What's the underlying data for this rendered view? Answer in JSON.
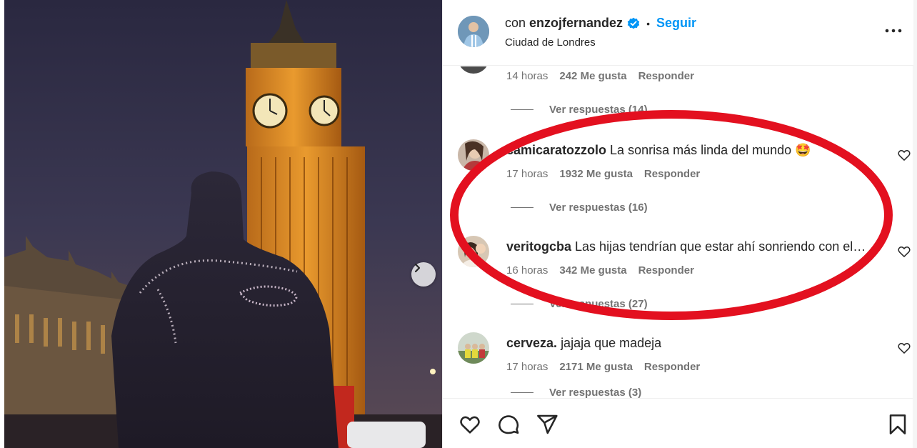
{
  "post": {
    "header": {
      "prefix": "con",
      "username": "enzojfernandez",
      "separator": "•",
      "follow_label": "Seguir",
      "location": "Ciudad de Londres",
      "more_icon": "more-horizontal-icon"
    },
    "carousel": {
      "next_icon": "chevron-right-icon"
    }
  },
  "comments": [
    {
      "user": "",
      "text": "",
      "time": "14 horas",
      "likes": "242 Me gusta",
      "reply": "Responder",
      "view_replies": "Ver respuestas (14)"
    },
    {
      "user": "camicaratozzolo",
      "text": "La sonrisa más linda del mundo 🤩",
      "time": "17 horas",
      "likes": "1932 Me gusta",
      "reply": "Responder",
      "view_replies": "Ver respuestas (16)"
    },
    {
      "user": "veritogcba",
      "text": "Las hijas tendrían que estar ahí sonriendo con el…",
      "time": "16 horas",
      "likes": "342 Me gusta",
      "reply": "Responder",
      "view_replies": "Ver respuestas (27)"
    },
    {
      "user": "cerveza.",
      "text": "jajaja que madeja",
      "time": "17 horas",
      "likes": "2171 Me gusta",
      "reply": "Responder",
      "view_replies": "Ver respuestas (3)"
    }
  ],
  "actions": {
    "like_icon": "heart-icon",
    "comment_icon": "comment-icon",
    "share_icon": "send-icon",
    "save_icon": "bookmark-icon"
  },
  "colors": {
    "accent": "#0095f6",
    "verified": "#0095f6",
    "annotation": "#e3101f",
    "muted_text": "#737373"
  }
}
